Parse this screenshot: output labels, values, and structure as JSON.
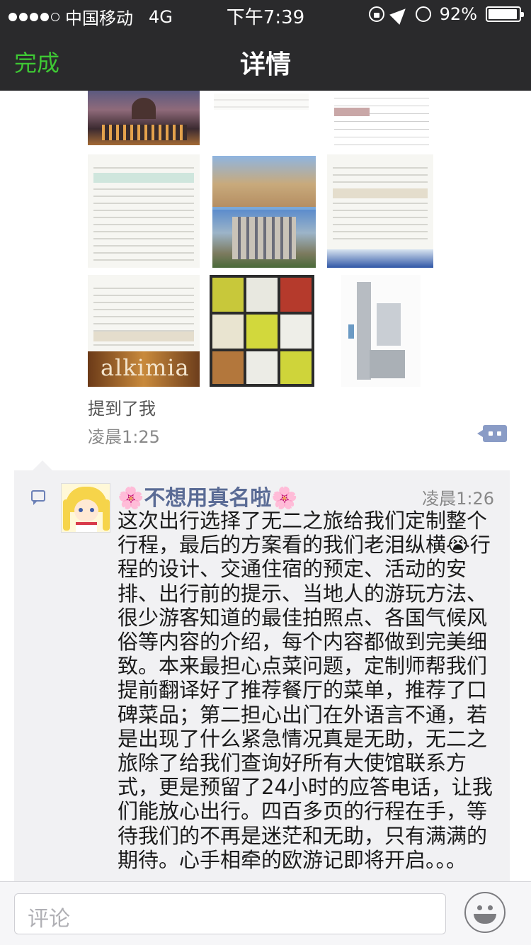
{
  "status": {
    "carrier": "中国移动",
    "network": "4G",
    "time": "下午7:39",
    "battery": "92%"
  },
  "nav": {
    "done": "完成",
    "title": "详情"
  },
  "post": {
    "images": [
      {
        "name": "florence-photo"
      },
      {
        "name": "itinerary-doc"
      },
      {
        "name": "table-doc"
      },
      {
        "name": "travel-notes-doc"
      },
      {
        "name": "gaudi-buildings-photo"
      },
      {
        "name": "hotel-doc"
      },
      {
        "name": "alkimia-restaurant"
      },
      {
        "name": "travel-booklets-photo"
      },
      {
        "name": "floorplan-map"
      }
    ],
    "caption": "提到了我",
    "time": "凌晨1:25"
  },
  "comment": {
    "nickname": "🌸不想用真名啦🌸",
    "time": "凌晨1:26",
    "text": "这次出行选择了无二之旅给我们定制整个\n行程，最后的方案看的我们老泪纵横😭行\n程的设计、交通住宿的预定、活动的安\n排、出行前的提示、当地人的游玩方法、\n很少游客知道的最佳拍照点、各国气候风\n俗等内容的介绍，每个内容都做到完美细\n致。本来最担心点菜问题，定制师帮我们\n提前翻译好了推荐餐厅的菜单，推荐了口\n碑菜品；第二担心出门在外语言不通，若\n是出现了什么紧急情况真是无助，无二之\n旅除了给我们查询好所有大使馆联系方\n式，更是预留了24小时的应答电话，让我\n们能放心出行。四百多页的行程在手，等\n待我们的不再是迷茫和无助，只有满满的\n期待。心手相牵的欧游记即将开启。。。",
    "image_text": "alkimia"
  },
  "input": {
    "placeholder": "评论"
  }
}
